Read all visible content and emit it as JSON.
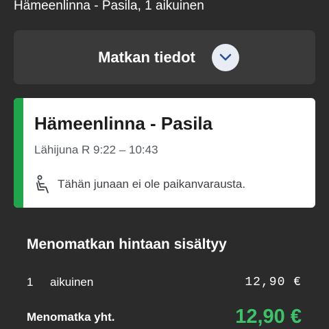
{
  "trip_title": "Hämeenlinna - Pasila, 1 aikuinen",
  "details_toggle": {
    "label": "Matkan tiedot",
    "icon": "chevron-down-icon"
  },
  "journey_card": {
    "title": "Hämeenlinna - Pasila",
    "train_info": "Lähijuna R 9:22 – 10:43",
    "seat_note": "Tähän junaan ei ole paikanvarausta.",
    "seat_icon": "seat-icon",
    "accent_color": "#1fa64a"
  },
  "price_section": {
    "heading": "Menomatkan hintaan sisältyy",
    "items": [
      {
        "quantity": "1",
        "type": "aikuinen",
        "price": "12,90 €"
      }
    ],
    "total_label": "Menomatka yht.",
    "total_value": "12,90 €",
    "total_color": "#3cc36a"
  }
}
